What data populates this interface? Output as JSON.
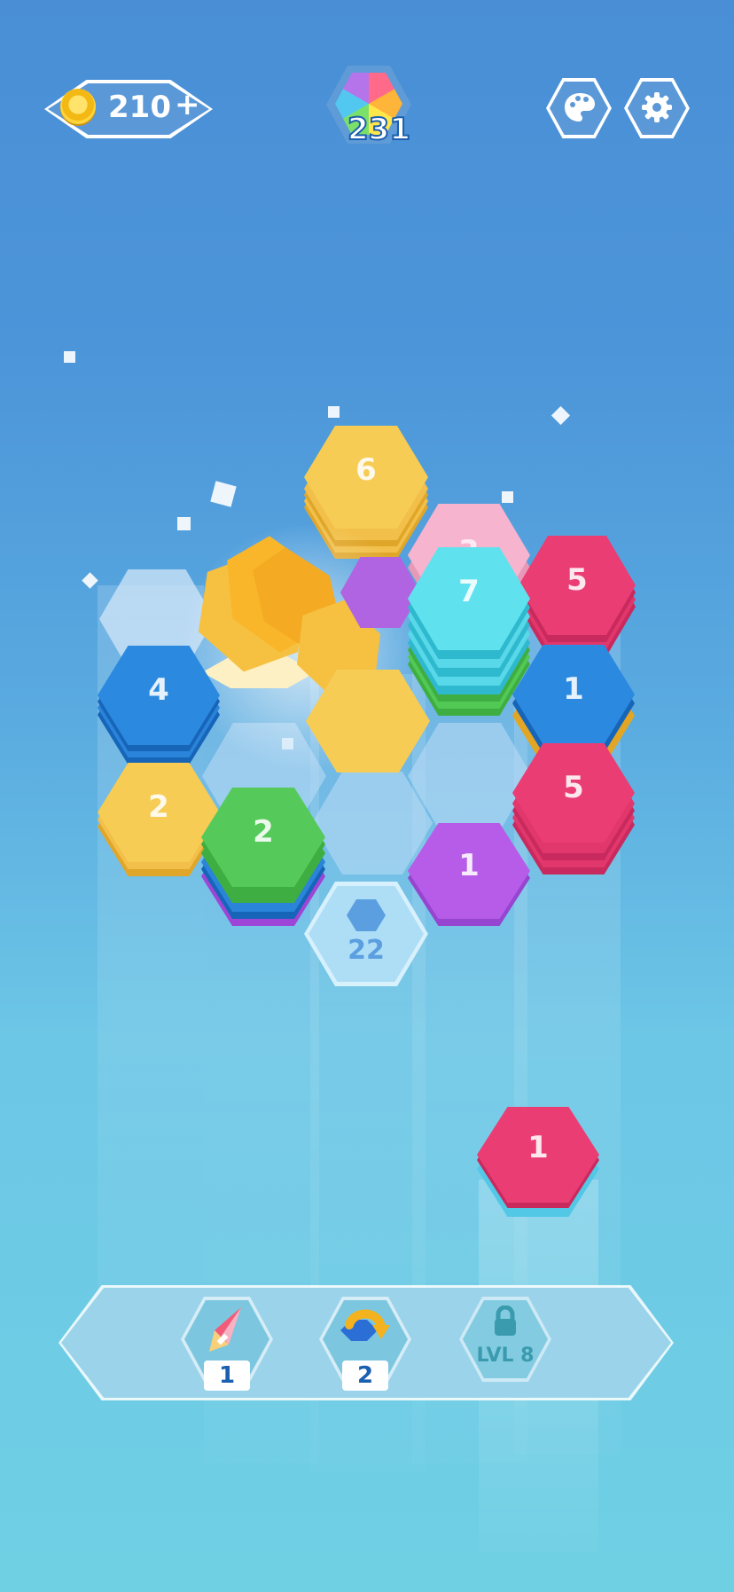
{
  "hud": {
    "coins": "210",
    "coins_add": "+",
    "level": "231",
    "palette_icon": "palette-icon",
    "settings_icon": "gear-icon"
  },
  "colors": {
    "yellow": "#f5c740",
    "pink": "#ec3f76",
    "blue": "#1f86e0",
    "cyan": "#4fdbe8",
    "green": "#4cc750",
    "purple": "#b95ae8"
  },
  "board": {
    "stacks": [
      {
        "id": "yellow-top",
        "count": "6",
        "color": "yellow"
      },
      {
        "id": "pink-back",
        "count": "3",
        "color": "pink-light"
      },
      {
        "id": "cyan",
        "count": "7",
        "color": "cyan"
      },
      {
        "id": "pink-right",
        "count": "5",
        "color": "pink"
      },
      {
        "id": "blue-left",
        "count": "4",
        "color": "blue"
      },
      {
        "id": "blue-right",
        "count": "1",
        "color": "blue"
      },
      {
        "id": "yellow-left",
        "count": "2",
        "color": "yellow"
      },
      {
        "id": "green",
        "count": "2",
        "color": "green"
      },
      {
        "id": "pink-lower",
        "count": "5",
        "color": "pink"
      },
      {
        "id": "purple",
        "count": "1",
        "color": "purple"
      }
    ],
    "locked_cell": "22",
    "next_stack": "1"
  },
  "boosters": [
    {
      "name": "rocket",
      "icon": "rocket-icon",
      "count": "1"
    },
    {
      "name": "swap",
      "icon": "swap-arrow-icon",
      "count": "2"
    },
    {
      "name": "locked",
      "icon": "lock-icon",
      "label": "LVL 8"
    }
  ]
}
